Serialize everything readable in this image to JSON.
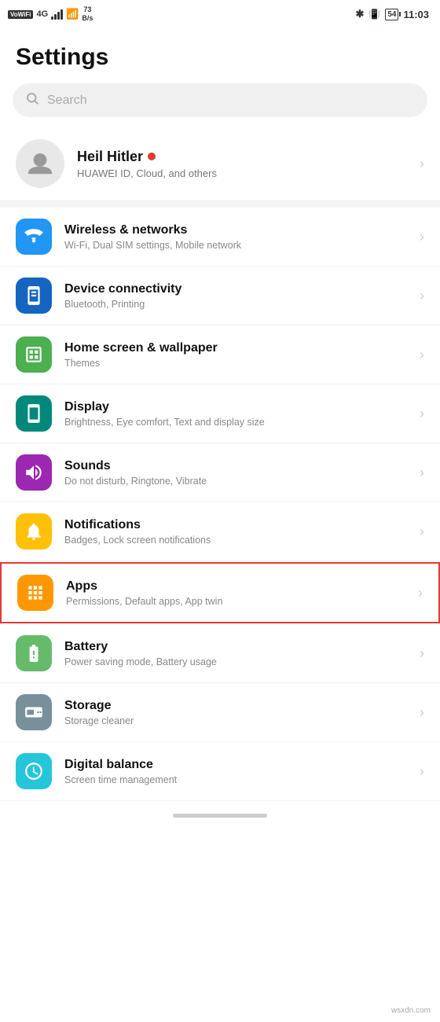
{
  "statusBar": {
    "carrier": "VoWiFi",
    "network": "4G",
    "speed": "73\nB/s",
    "time": "11:03",
    "battery": "54"
  },
  "page": {
    "title": "Settings"
  },
  "search": {
    "placeholder": "Search"
  },
  "profile": {
    "name": "Heil Hitler",
    "subtext": "HUAWEI ID, Cloud, and others"
  },
  "settingsItems": [
    {
      "id": "wireless",
      "title": "Wireless & networks",
      "subtitle": "Wi-Fi, Dual SIM settings, Mobile network",
      "iconColor": "blue",
      "iconSymbol": "📶"
    },
    {
      "id": "device-connectivity",
      "title": "Device connectivity",
      "subtitle": "Bluetooth, Printing",
      "iconColor": "blue2",
      "iconSymbol": "🔵"
    },
    {
      "id": "home-screen",
      "title": "Home screen & wallpaper",
      "subtitle": "Themes",
      "iconColor": "green",
      "iconSymbol": "🖼"
    },
    {
      "id": "display",
      "title": "Display",
      "subtitle": "Brightness, Eye comfort, Text and display size",
      "iconColor": "green2",
      "iconSymbol": "📱"
    },
    {
      "id": "sounds",
      "title": "Sounds",
      "subtitle": "Do not disturb, Ringtone, Vibrate",
      "iconColor": "purple",
      "iconSymbol": "🔊"
    },
    {
      "id": "notifications",
      "title": "Notifications",
      "subtitle": "Badges, Lock screen notifications",
      "iconColor": "yellow",
      "iconSymbol": "🔔"
    },
    {
      "id": "apps",
      "title": "Apps",
      "subtitle": "Permissions, Default apps, App twin",
      "iconColor": "orange",
      "iconSymbol": "⊞",
      "highlighted": true
    },
    {
      "id": "battery",
      "title": "Battery",
      "subtitle": "Power saving mode, Battery usage",
      "iconColor": "light-green",
      "iconSymbol": "🔋"
    },
    {
      "id": "storage",
      "title": "Storage",
      "subtitle": "Storage cleaner",
      "iconColor": "gray",
      "iconSymbol": "💾"
    },
    {
      "id": "digital-balance",
      "title": "Digital balance",
      "subtitle": "Screen time management",
      "iconColor": "teal",
      "iconSymbol": "⏱"
    }
  ],
  "watermark": "wsxdn.com"
}
